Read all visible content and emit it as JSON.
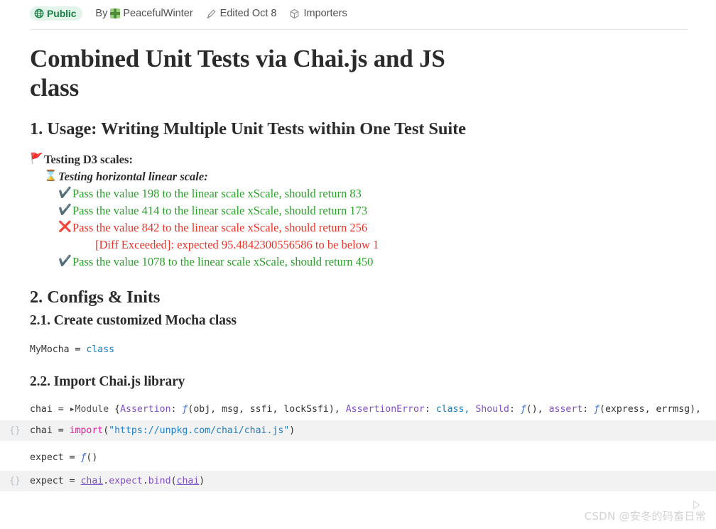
{
  "header": {
    "visibility_badge": "Public",
    "by_label": "By",
    "author": "PeacefulWinter",
    "edited": "Edited Oct 8",
    "importers": "Importers",
    "icons": {
      "globe": "globe-icon",
      "avatar": "user-avatar",
      "pencil": "pencil-icon",
      "cube": "cube-icon"
    },
    "accent_green": "#1a7f46",
    "badge_bg": "#e3f5ea"
  },
  "document": {
    "title": "Combined Unit Tests via Chai.js and JS class",
    "sections": [
      {
        "heading": "1. Usage: Writing Multiple Unit Tests within One Test Suite"
      },
      {
        "heading": "2. Configs & Inits"
      }
    ],
    "subheadings": {
      "s21": "2.1. Create customized Mocha class",
      "s22": "2.2. Import Chai.js library"
    }
  },
  "test_tree": {
    "suite": {
      "icon": "🚩",
      "label": "Testing D3 scales:"
    },
    "case": {
      "icon": "⌛",
      "label": "Testing horizontal linear scale:"
    },
    "results": [
      {
        "icon": "✔️",
        "status": "pass",
        "text": "Pass the value 198 to the linear scale xScale, should return 83"
      },
      {
        "icon": "✔️",
        "status": "pass",
        "text": "Pass the value 414 to the linear scale xScale, should return 173"
      },
      {
        "icon": "❌",
        "status": "fail",
        "text": "Pass the value 842 to the linear scale xScale, should return 256"
      },
      {
        "icon": "✔️",
        "status": "pass",
        "text": "Pass the value 1078 to the linear scale xScale, should return 450"
      }
    ],
    "diff_message": "[Diff Exceeded]: expected 95.4842300556586 to be below 1"
  },
  "cells": {
    "mymocha_output": {
      "name": "MyMocha",
      "eq": " = ",
      "value": "class"
    },
    "chai_output": {
      "prefix": "chai = ",
      "triangle": "▸",
      "module": "Module ",
      "brace_open": "{",
      "p1": "Assertion",
      "v1": "(obj, msg, ssfi, lockSsfi), ",
      "p2": "AssertionError",
      "v2": "class, ",
      "p3": "Should",
      "v3": "(), ",
      "p4": "assert",
      "v4": "(express, errmsg),"
    },
    "chai_import": {
      "gutter": "{}",
      "lhs": "chai = ",
      "keyword": "import",
      "paren_open": "(",
      "url": "\"https://unpkg.com/chai/chai.js\"",
      "paren_close": ")",
      "run_icon": "play-icon"
    },
    "expect_output": {
      "prefix": "expect = ",
      "fn": "ƒ",
      "suffix": "()"
    },
    "expect_cell": {
      "gutter": "{}",
      "lhs": "expect = ",
      "link1": "chai",
      "mid": ".",
      "prop": "expect",
      "dot2": ".",
      "method": "bind",
      "paren_open": "(",
      "link2": "chai",
      "paren_close": ")"
    }
  },
  "watermark": "CSDN @安冬的码畜日常"
}
